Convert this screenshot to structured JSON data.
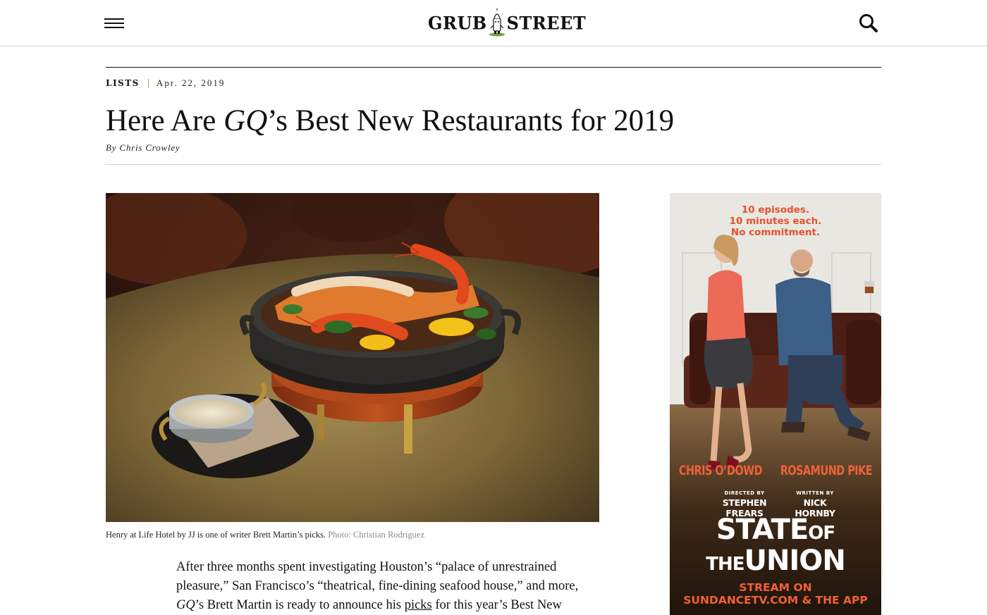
{
  "header": {
    "logo_left": "GRUB",
    "logo_right": "STREET"
  },
  "article": {
    "rubric": "Lists",
    "date": "Apr. 22, 2019",
    "headline_pre": "Here Are ",
    "headline_em": "GQ",
    "headline_post": "’s Best New Restaurants for 2019",
    "byline_prefix": "By ",
    "author": "Chris Crowley",
    "caption": "Henry at Life Hotel by JJ is one of writer Brett Martin’s picks.",
    "photo_credit": "Photo: Christian Rodriguez",
    "body": {
      "p1_a": "After three months spent investigating Houston’s “palace of unrestrained pleasure,” San Francisco’s “theatrical, fine-dining seafood house,” and more, ",
      "p1_em": "GQ",
      "p1_b": "’s Brett Martin is ready to announce his ",
      "p1_link": "picks",
      "p1_c": " for this year’s Best New"
    }
  },
  "ad": {
    "tagline": [
      "10 episodes.",
      "10 minutes each.",
      "No commitment."
    ],
    "cast": [
      "CHRIS O’DOWD",
      "ROSAMUND PIKE"
    ],
    "credits": [
      {
        "role": "DIRECTED BY",
        "name": "STEPHEN FREARS"
      },
      {
        "role": "WRITTEN BY",
        "name": "NICK HORNBY"
      }
    ],
    "title_a": "STATE",
    "title_b": "OF",
    "title_c": "THE",
    "title_d": "UNION",
    "cta": [
      "STREAM ON",
      "SUNDANCETV.COM & THE APP"
    ]
  },
  "icons": {
    "menu": "hamburger-icon",
    "search": "search-icon",
    "mascot": "grub-street-mascot-icon"
  },
  "colors": {
    "rubric_separator": "#b8a35a",
    "ad_accent": "#f0603a"
  }
}
